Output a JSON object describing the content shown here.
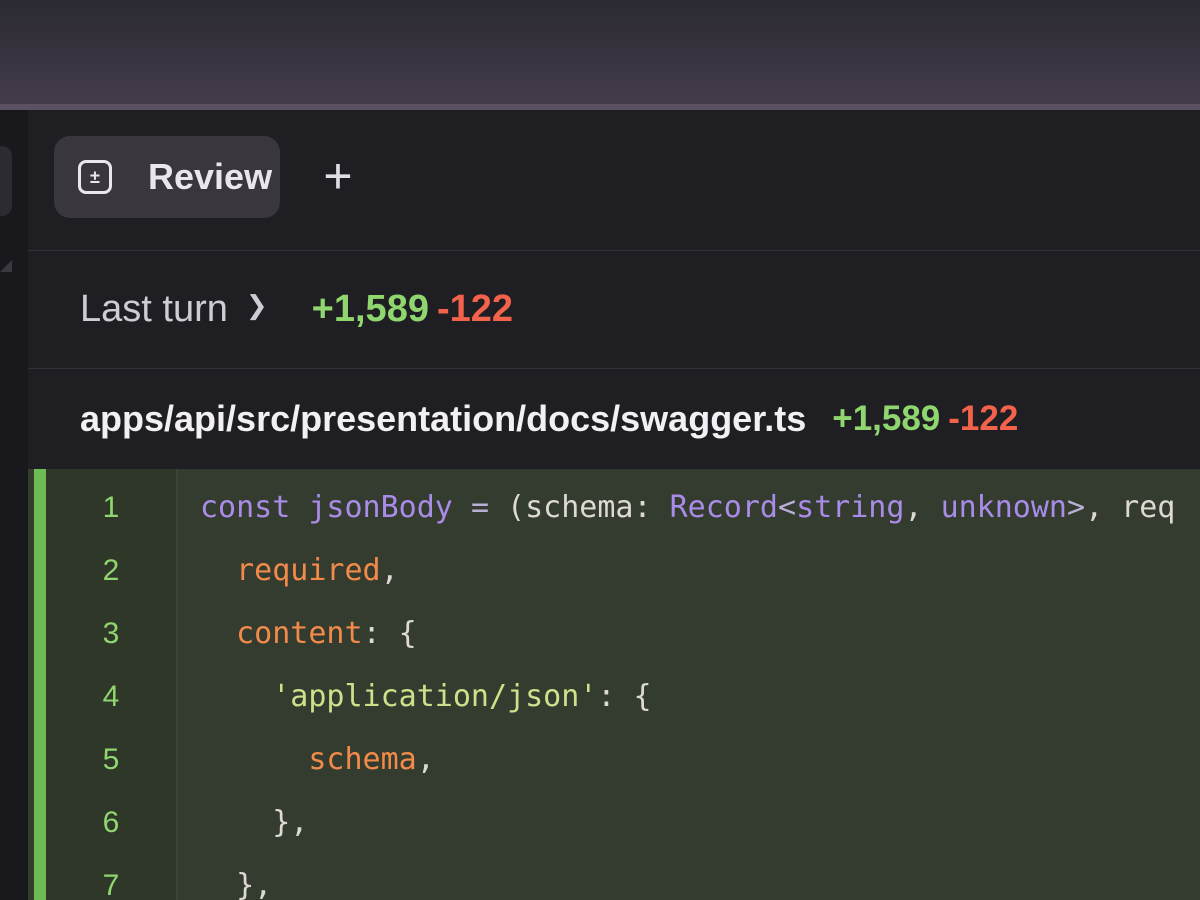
{
  "tabs": [
    {
      "label": "Review",
      "icon": "plus-minus-icon"
    }
  ],
  "add_tab_glyph": "+",
  "turn": {
    "label": "Last turn",
    "additions": "+1,589",
    "deletions": "-122"
  },
  "file": {
    "path": "apps/api/src/presentation/docs/swagger.ts",
    "additions": "+1,589",
    "deletions": "-122"
  },
  "code_lines": [
    {
      "n": "1",
      "tokens": [
        {
          "t": "const",
          "c": "kw"
        },
        {
          "t": " ",
          "c": "pl"
        },
        {
          "t": "jsonBody",
          "c": "fn"
        },
        {
          "t": " ",
          "c": "pl"
        },
        {
          "t": "=",
          "c": "op"
        },
        {
          "t": " (schema: ",
          "c": "pl"
        },
        {
          "t": "Record",
          "c": "ty"
        },
        {
          "t": "<",
          "c": "op"
        },
        {
          "t": "string",
          "c": "ty"
        },
        {
          "t": ", ",
          "c": "pl"
        },
        {
          "t": "unknown",
          "c": "ty"
        },
        {
          "t": ">",
          "c": "op"
        },
        {
          "t": ", req",
          "c": "pl"
        }
      ]
    },
    {
      "n": "2",
      "tokens": [
        {
          "t": "  ",
          "c": "pl"
        },
        {
          "t": "required",
          "c": "prop"
        },
        {
          "t": ",",
          "c": "pl"
        }
      ]
    },
    {
      "n": "3",
      "tokens": [
        {
          "t": "  ",
          "c": "pl"
        },
        {
          "t": "content",
          "c": "prop"
        },
        {
          "t": ": {",
          "c": "pl"
        }
      ]
    },
    {
      "n": "4",
      "tokens": [
        {
          "t": "    ",
          "c": "pl"
        },
        {
          "t": "'application/json'",
          "c": "str"
        },
        {
          "t": ": {",
          "c": "pl"
        }
      ]
    },
    {
      "n": "5",
      "tokens": [
        {
          "t": "      ",
          "c": "pl"
        },
        {
          "t": "schema",
          "c": "prop"
        },
        {
          "t": ",",
          "c": "pl"
        }
      ]
    },
    {
      "n": "6",
      "tokens": [
        {
          "t": "    },",
          "c": "pl"
        }
      ]
    },
    {
      "n": "7",
      "tokens": [
        {
          "t": "  },",
          "c": "pl"
        }
      ]
    }
  ],
  "colors": {
    "added_text": "#8fd66f",
    "deleted_text": "#f3624a",
    "diff_background": "#343b2f",
    "keyword": "#a98ce8",
    "property": "#f28b4a",
    "string": "#cfe08a"
  }
}
